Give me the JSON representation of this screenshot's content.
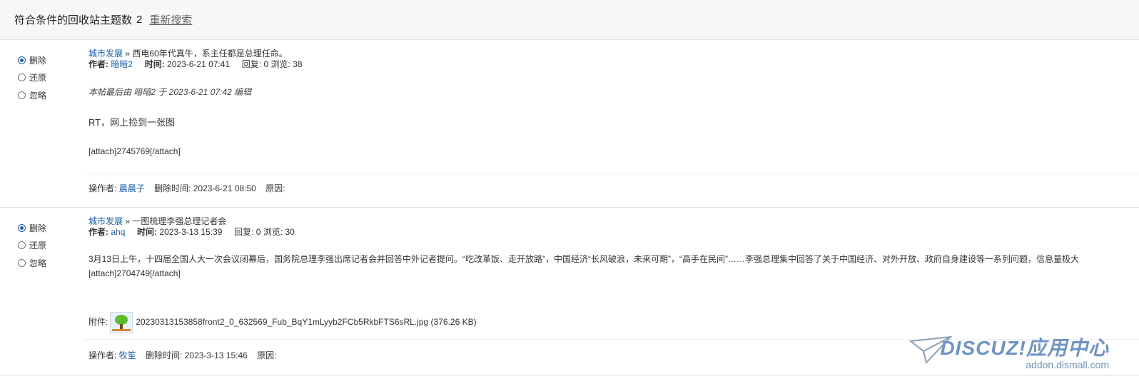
{
  "header": {
    "title": "符合条件的回收站主题数",
    "count": "2",
    "research_label": "重新搜索"
  },
  "radio_labels": {
    "delete": "删除",
    "restore": "还原",
    "ignore": "忽略"
  },
  "labels": {
    "author": "作者:",
    "time": "时间:",
    "operator": "操作者:",
    "delete_time": "删除时间:",
    "reason": "原因:",
    "attachment": "附件:",
    "breadcrumb_sep": "»"
  },
  "posts": [
    {
      "selected_action": "delete",
      "forum": "城市发展",
      "subject": "西电60年代真牛，系主任都是总理任命。",
      "author": "暗暗2",
      "time": "2023-6-21 07:41",
      "stats": "回复: 0 浏览: 38",
      "edit_note": "本帖最后由 暗暗2 于 2023-6-21 07:42 编辑",
      "body": "RT，网上捡到一张图",
      "attach_code": "[attach]2745769[/attach]",
      "operator": "晨晨子",
      "delete_time": "2023-6-21 08:50",
      "reason": ""
    },
    {
      "selected_action": "delete",
      "forum": "城市发展",
      "subject": "一图梳理李强总理记者会",
      "author": "ahq",
      "time": "2023-3-13 15:39",
      "stats": "回复: 0 浏览: 30",
      "body": "3月13日上午，十四届全国人大一次会议闭幕后，国务院总理李强出席记者会并回答中外记者提问。“吃改革饭、走开放路”，中国经济“长风破浪，未来可期”，“高手在民间”……李强总理集中回答了关于中国经济、对外开放、政府自身建设等一系列问题，信息量极大",
      "attach_code": "[attach]2704749[/attach]",
      "attachment": {
        "filename": "20230313153858front2_0_632569_Fub_BqY1mLyyb2FCb5RkbFTS6sRL.jpg",
        "size": "(376.26 KB)"
      },
      "operator": "牧笙",
      "delete_time": "2023-3-13 15:46",
      "reason": ""
    }
  ],
  "watermark": {
    "logo_text": "DISCUZ!应用中心",
    "url": "addon.dismall.com"
  }
}
